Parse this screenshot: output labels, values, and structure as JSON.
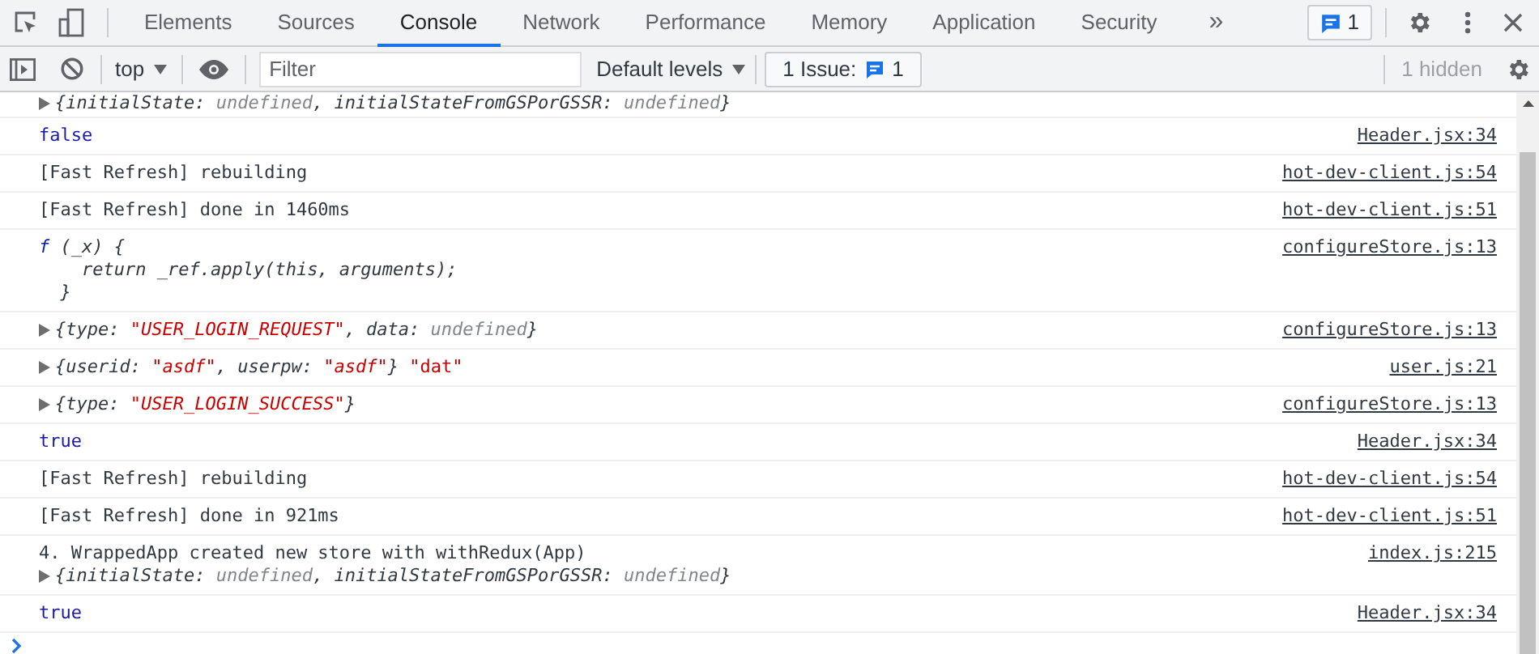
{
  "tabs": [
    {
      "label": "Elements",
      "selected": false
    },
    {
      "label": "Sources",
      "selected": false
    },
    {
      "label": "Console",
      "selected": true
    },
    {
      "label": "Network",
      "selected": false
    },
    {
      "label": "Performance",
      "selected": false
    },
    {
      "label": "Memory",
      "selected": false
    },
    {
      "label": "Application",
      "selected": false
    },
    {
      "label": "Security",
      "selected": false
    }
  ],
  "more_tabs": "»",
  "message_badge": "1",
  "toolbar": {
    "context": "top",
    "filter": {
      "placeholder": "Filter"
    },
    "levels": "Default levels",
    "issues_label": "1 Issue:",
    "issues_count": "1",
    "hidden": "1 hidden"
  },
  "logs": [
    {
      "kind": "object",
      "lines": [
        [
          {
            "text": "{initialState: ",
            "kind": "key"
          },
          {
            "text": "undefined",
            "kind": "muted"
          },
          {
            "text": ", initialStateFromGSPorGSSR: ",
            "kind": "key"
          },
          {
            "text": "undefined",
            "kind": "muted"
          },
          {
            "text": "}",
            "kind": "key"
          }
        ]
      ]
    },
    {
      "kind": "boolean",
      "lines": [
        [
          {
            "text": "false",
            "kind": "plain"
          }
        ]
      ],
      "source": "Header.jsx:34"
    },
    {
      "kind": "text",
      "lines": [
        [
          {
            "text": "[Fast Refresh] rebuilding",
            "kind": "plain"
          }
        ]
      ],
      "source": "hot-dev-client.js:54"
    },
    {
      "kind": "text",
      "lines": [
        [
          {
            "text": "[Fast Refresh] done in 1460ms",
            "kind": "plain"
          }
        ]
      ],
      "source": "hot-dev-client.js:51"
    },
    {
      "kind": "function",
      "lines": [
        [
          {
            "text": "f",
            "kind": "keyword"
          },
          {
            "text": " (_x) {",
            "kind": "code"
          }
        ],
        [
          {
            "text": "    return _ref.apply(this, arguments);",
            "kind": "code"
          }
        ],
        [
          {
            "text": "  }",
            "kind": "code"
          }
        ]
      ],
      "source": "configureStore.js:13"
    },
    {
      "kind": "object",
      "lines": [
        [
          {
            "text": "{type: ",
            "kind": "key"
          },
          {
            "text": "\"USER_LOGIN_REQUEST\"",
            "kind": "string"
          },
          {
            "text": ", data: ",
            "kind": "key"
          },
          {
            "text": "undefined",
            "kind": "muted"
          },
          {
            "text": "}",
            "kind": "key"
          }
        ]
      ],
      "source": "configureStore.js:13"
    },
    {
      "kind": "object",
      "lines": [
        [
          {
            "text": "{userid: ",
            "kind": "key"
          },
          {
            "text": "\"asdf\"",
            "kind": "string"
          },
          {
            "text": ", userpw: ",
            "kind": "key"
          },
          {
            "text": "\"asdf\"",
            "kind": "string"
          },
          {
            "text": "}",
            "kind": "key"
          },
          {
            "text": " \"dat\"",
            "kind": "plain_string"
          }
        ]
      ],
      "source": "user.js:21"
    },
    {
      "kind": "object",
      "lines": [
        [
          {
            "text": "{type: ",
            "kind": "key"
          },
          {
            "text": "\"USER_LOGIN_SUCCESS\"",
            "kind": "string"
          },
          {
            "text": "}",
            "kind": "key"
          }
        ]
      ],
      "source": "configureStore.js:13"
    },
    {
      "kind": "boolean",
      "lines": [
        [
          {
            "text": "true",
            "kind": "plain"
          }
        ]
      ],
      "source": "Header.jsx:34"
    },
    {
      "kind": "text",
      "lines": [
        [
          {
            "text": "[Fast Refresh] rebuilding",
            "kind": "plain"
          }
        ]
      ],
      "source": "hot-dev-client.js:54"
    },
    {
      "kind": "text",
      "lines": [
        [
          {
            "text": "[Fast Refresh] done in 921ms",
            "kind": "plain"
          }
        ]
      ],
      "source": "hot-dev-client.js:51"
    },
    {
      "kind": "text_object",
      "lines": [
        [
          {
            "text": "4. WrappedApp created new store with withRedux(App)",
            "kind": "plain"
          }
        ],
        [
          {
            "text": "{initialState: ",
            "kind": "key"
          },
          {
            "text": "undefined",
            "kind": "muted"
          },
          {
            "text": ", initialStateFromGSPorGSSR: ",
            "kind": "key"
          },
          {
            "text": "undefined",
            "kind": "muted"
          },
          {
            "text": "}",
            "kind": "key"
          }
        ]
      ],
      "source": "index.js:215"
    },
    {
      "kind": "boolean",
      "lines": [
        [
          {
            "text": "true",
            "kind": "plain"
          }
        ]
      ],
      "source": "Header.jsx:34"
    }
  ]
}
